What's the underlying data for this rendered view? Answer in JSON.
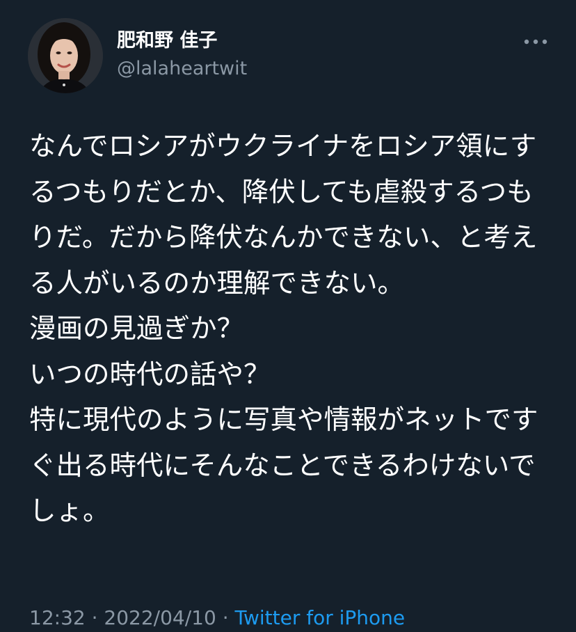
{
  "tweet": {
    "author_name": "肥和野 佳子",
    "author_handle": "@lalaheartwit",
    "text": "なんでロシアがウクライナをロシア領にするつもりだとか、降伏しても虐殺するつもりだ。だから降伏なんかできない、と考える人がいるのか理解できない。\n漫画の見過ぎか？\nいつの時代の話や？\n特に現代のように写真や情報がネットですぐ出る時代にそんなことできるわけないでしょ。",
    "time": "12:32",
    "separator": " · ",
    "date": "2022/04/10",
    "source": "Twitter for iPhone"
  },
  "icons": {
    "more": "more-horizontal-icon",
    "avatar": "profile-photo"
  },
  "colors": {
    "background": "#15202b",
    "text_primary": "#ffffff",
    "text_secondary": "#8b98a5",
    "link": "#1d9bf0"
  }
}
